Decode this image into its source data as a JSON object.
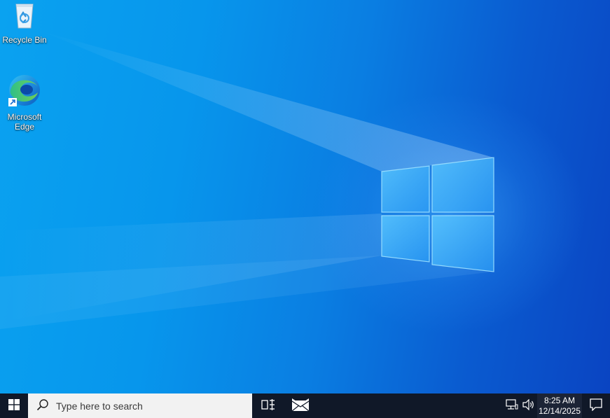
{
  "desktop": {
    "icons": [
      {
        "label": "Recycle Bin",
        "icon": "recycle-bin-icon"
      },
      {
        "label": "Microsoft Edge",
        "icon": "edge-icon"
      }
    ]
  },
  "taskbar": {
    "start_icon": "windows-logo-icon",
    "search": {
      "placeholder": "Type here to search",
      "icon": "search-icon"
    },
    "task_view_icon": "task-view-icon",
    "mail_icon": "mail-icon",
    "tray": {
      "network_icon": "network-icon",
      "volume_icon": "volume-icon",
      "time": "8:25 AM",
      "date": "12/14/2025",
      "notifications_icon": "notification-icon"
    }
  },
  "colors": {
    "taskbar_bg": "#101828",
    "wallpaper_blue": "#0a7ee2",
    "search_bg": "#f2f2f2"
  }
}
